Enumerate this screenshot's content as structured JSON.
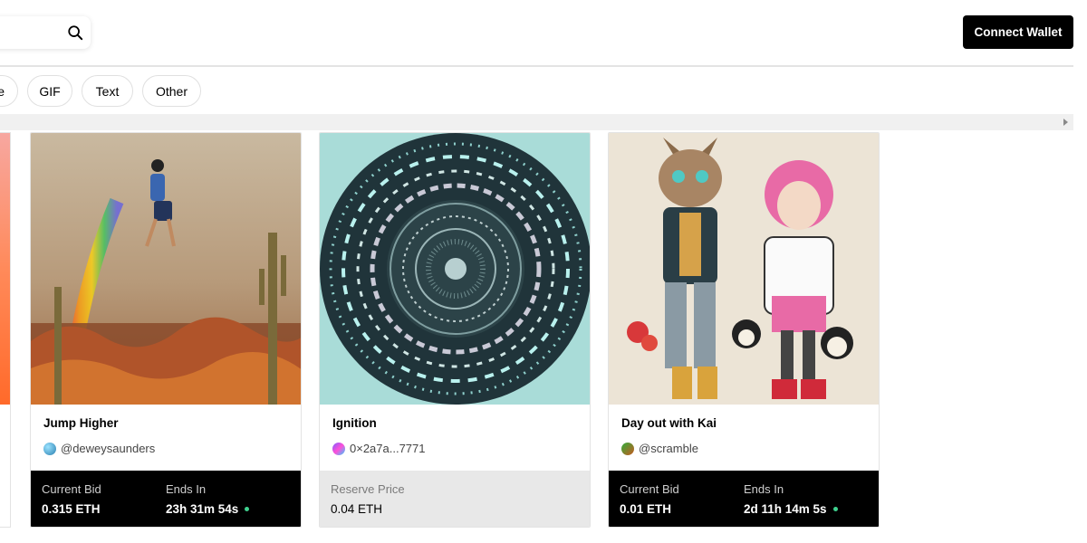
{
  "header": {
    "search": {
      "placeholder": "",
      "icon": "search-icon"
    },
    "connect_label": "Connect Wallet"
  },
  "filters": [
    {
      "label": "e",
      "partial": true
    },
    {
      "label": "GIF"
    },
    {
      "label": "Text"
    },
    {
      "label": "Other"
    }
  ],
  "colors": {
    "brand": "#000000",
    "live_dot": "#3fd18f",
    "footer_dark": "#000000",
    "footer_light": "#e8e8e8"
  },
  "cards": [
    {
      "title": "Jump Higher",
      "creator": "@deweysaunders",
      "status": "auction",
      "bid_label": "Current Bid",
      "bid_value": "0.315 ETH",
      "ends_label": "Ends In",
      "ends_value": "23h 31m 54s"
    },
    {
      "title": "Ignition",
      "creator": "0×2a7a...7771",
      "status": "reserve",
      "bid_label": "Reserve Price",
      "bid_value": "0.04 ETH"
    },
    {
      "title": "Day out with Kai",
      "creator": "@scramble",
      "status": "auction",
      "bid_label": "Current Bid",
      "bid_value": "0.01 ETH",
      "ends_label": "Ends In",
      "ends_value": "2d 11h 14m 5s"
    }
  ]
}
